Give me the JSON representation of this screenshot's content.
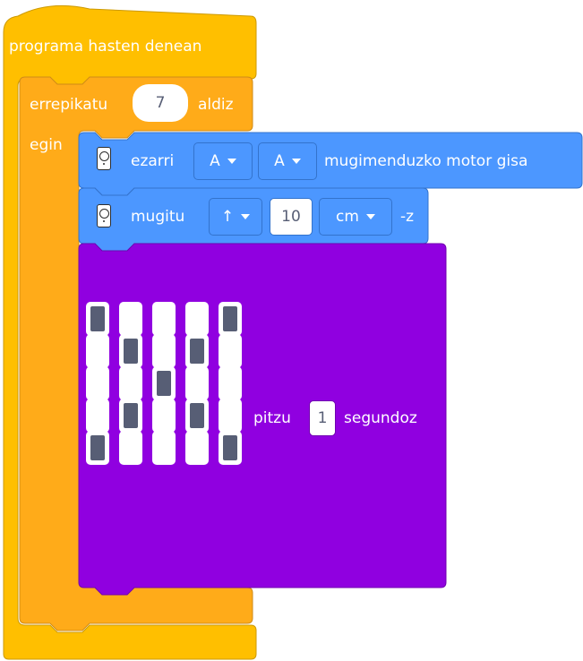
{
  "hat_block": {
    "label": "programa hasten denean",
    "color": "#ffbf00"
  },
  "repeat_block": {
    "label_before": "errepikatu",
    "count": "7",
    "label_after": "aldiz",
    "do_label": "egin",
    "color": "#ffab19"
  },
  "motor_set_block": {
    "icon": "robot-icon",
    "label": "ezarri",
    "port_1": "A",
    "port_2": "A",
    "label_after": "mugimenduzko motor gisa",
    "color": "#4c97ff"
  },
  "move_block": {
    "icon": "robot-icon",
    "label": "mugitu",
    "direction": "↑",
    "distance": "10",
    "unit": "cm",
    "suffix": "-z",
    "color": "#4c97ff"
  },
  "light_block": {
    "matrix": [
      [
        1,
        0,
        0,
        0,
        1
      ],
      [
        0,
        1,
        0,
        1,
        0
      ],
      [
        0,
        0,
        1,
        0,
        0
      ],
      [
        0,
        1,
        0,
        1,
        0
      ],
      [
        1,
        0,
        0,
        0,
        1
      ]
    ],
    "label": "pitzu",
    "seconds": "1",
    "label_after": "segundoz",
    "color": "#9000e0"
  }
}
